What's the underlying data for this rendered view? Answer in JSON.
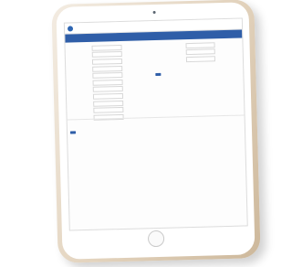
{
  "app": {
    "logo_text": "",
    "nav": [
      "",
      "",
      "",
      ""
    ],
    "user": [
      "",
      ""
    ]
  },
  "titlebar": {
    "title": "",
    "actions": [
      "",
      ""
    ]
  },
  "left_form": {
    "rows": [
      {
        "label": "",
        "value": ""
      },
      {
        "label": "",
        "value": ""
      },
      {
        "label": "",
        "value": ""
      },
      {
        "label": "",
        "value": ""
      },
      {
        "label": "",
        "value": ""
      },
      {
        "label": "",
        "value": ""
      },
      {
        "label": "",
        "value": ""
      },
      {
        "label": "",
        "value": ""
      },
      {
        "label": "",
        "value": ""
      },
      {
        "label": "",
        "value": ""
      },
      {
        "label": "",
        "value": ""
      }
    ],
    "button": ""
  },
  "right_form": {
    "rows": [
      {
        "label": ""
      },
      {
        "label": ""
      },
      {
        "label": ""
      }
    ],
    "button": ""
  },
  "footer_link": ""
}
